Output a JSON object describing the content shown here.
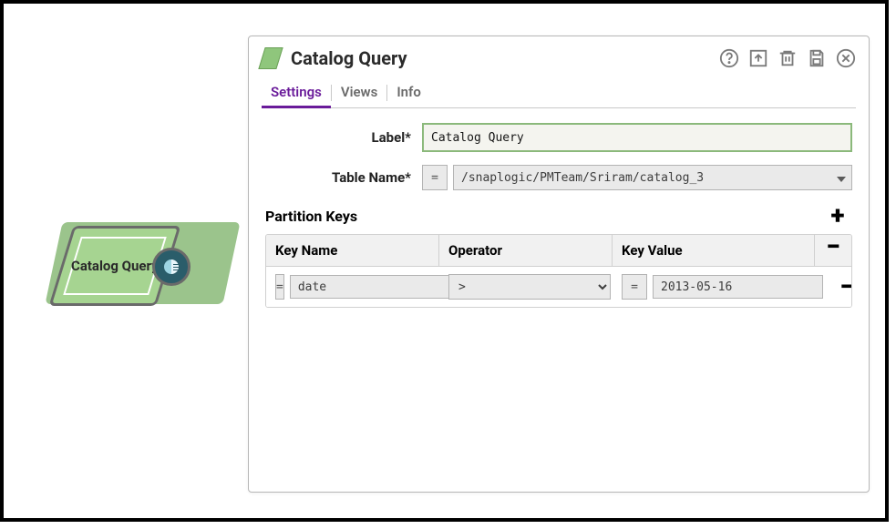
{
  "canvas": {
    "snap": {
      "label": "Catalog Query"
    }
  },
  "panel": {
    "title": "Catalog Query",
    "tabs": [
      "Settings",
      "Views",
      "Info"
    ],
    "form": {
      "eq_symbol": "=",
      "label_field": {
        "label": "Label*",
        "value": "Catalog Query"
      },
      "table_name": {
        "label": "Table Name*",
        "value": "/snaplogic/PMTeam/Sriram/catalog_3"
      },
      "partition_keys": {
        "label": "Partition Keys",
        "columns": [
          "Key Name",
          "Operator",
          "Key Value"
        ],
        "rows": [
          {
            "key_name": "date",
            "operator": ">",
            "key_value": "2013-05-16"
          }
        ]
      }
    }
  }
}
